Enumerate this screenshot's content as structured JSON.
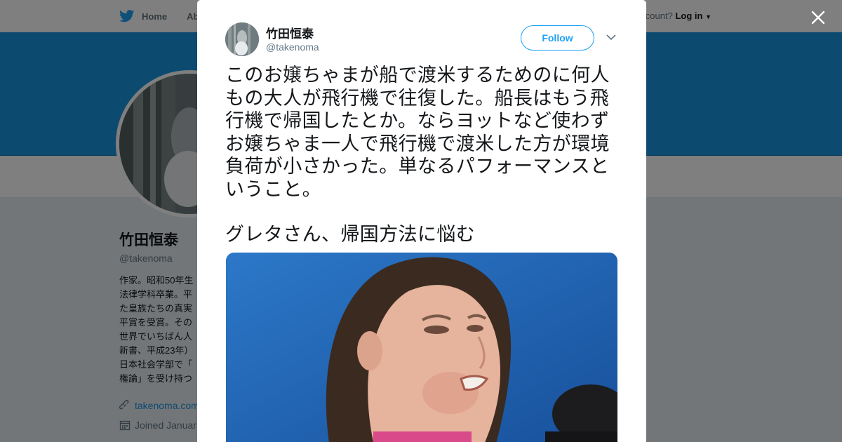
{
  "topbar": {
    "home_label": "Home",
    "about_label": "Abo",
    "account_prompt": "ccount?",
    "login_label": "Log in"
  },
  "profile": {
    "name": "竹田恒泰",
    "handle": "@takenoma",
    "bio_lines": [
      "作家。昭和50年生",
      "法律学科卒業。平",
      "た皇族たちの真実",
      "平賞を受賞。その",
      "世界でいちばん人",
      "新書、平成23年）",
      "日本社会学部で「",
      "権論」を受け持つ"
    ],
    "website": "takenoma.com",
    "joined": "Joined Januar"
  },
  "tweet": {
    "author_name": "竹田恒泰",
    "author_handle": "@takenoma",
    "follow_label": "Follow",
    "text_lines": [
      "このお嬢ちゃまが船で渡米するためのに何人",
      "もの大人が飛行機で往復した。船長はもう飛",
      "行機で帰国したとか。ならヨットなど使わず",
      "お嬢ちゃま一人で飛行機で渡米した方が環境",
      "負荷が小さかった。単なるパフォーマンスと",
      "いうこと。"
    ],
    "card_title": "グレタさん、帰国方法に悩む"
  },
  "colors": {
    "accent": "#1da1f2",
    "banner": "#1b95e0",
    "media_bg": "#1f67b8"
  },
  "icons": {
    "bird": "twitter-bird-icon",
    "close": "close-icon",
    "caret": "chevron-down-icon",
    "link": "link-icon",
    "calendar": "calendar-icon"
  }
}
